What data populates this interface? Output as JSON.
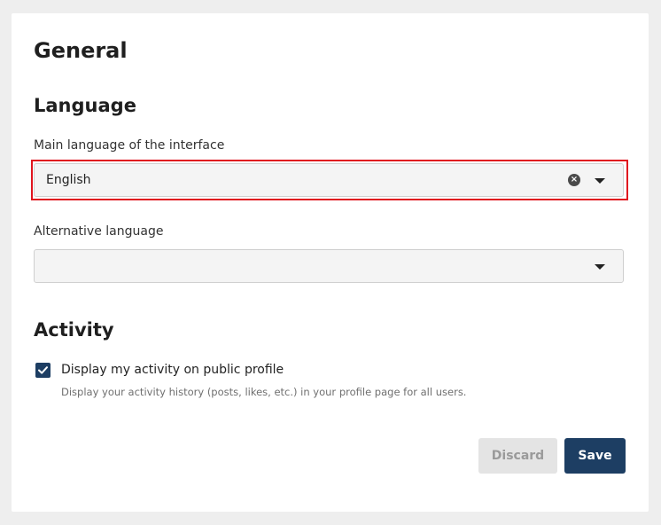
{
  "page": {
    "title": "General"
  },
  "language_section": {
    "heading": "Language",
    "main_language": {
      "label": "Main language of the interface",
      "value": "English"
    },
    "alt_language": {
      "label": "Alternative language",
      "value": ""
    }
  },
  "activity_section": {
    "heading": "Activity",
    "public_activity": {
      "checked": true,
      "label": "Display my activity on public profile",
      "help": "Display your activity history (posts, likes, etc.) in your profile page for all users."
    }
  },
  "actions": {
    "discard_label": "Discard",
    "save_label": "Save"
  },
  "colors": {
    "primary": "#1d3e63",
    "highlight": "#e0141e",
    "disabled": "#e4e4e4"
  }
}
